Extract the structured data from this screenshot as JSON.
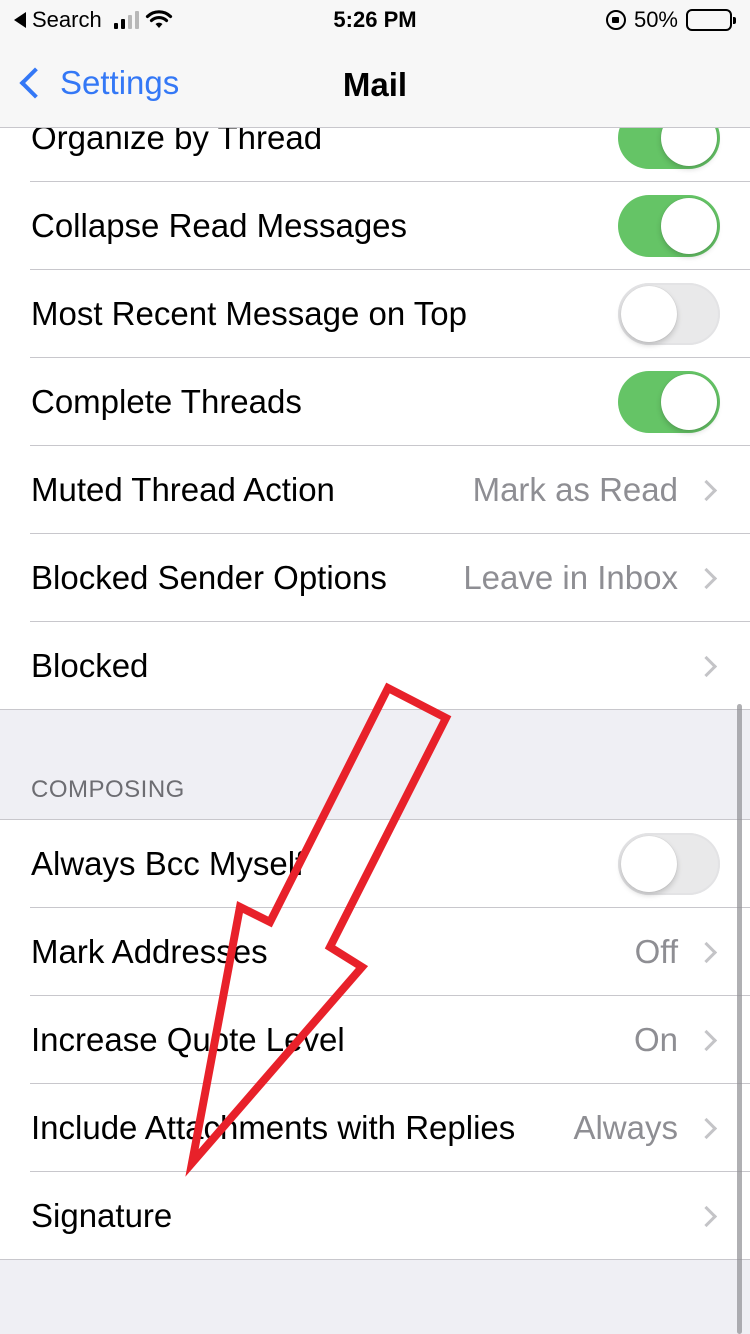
{
  "status_bar": {
    "back_app": "Search",
    "time": "5:26 PM",
    "battery_percent": "50%",
    "battery_level": 0.5
  },
  "nav": {
    "back_label": "Settings",
    "title": "Mail"
  },
  "threading_rows": [
    {
      "label": "Organize by Thread",
      "control": "toggle",
      "on": true
    },
    {
      "label": "Collapse Read Messages",
      "control": "toggle",
      "on": true
    },
    {
      "label": "Most Recent Message on Top",
      "control": "toggle",
      "on": false
    },
    {
      "label": "Complete Threads",
      "control": "toggle",
      "on": true
    },
    {
      "label": "Muted Thread Action",
      "value": "Mark as Read",
      "control": "disclosure"
    },
    {
      "label": "Blocked Sender Options",
      "value": "Leave in Inbox",
      "control": "disclosure"
    },
    {
      "label": "Blocked",
      "control": "disclosure"
    }
  ],
  "composing": {
    "header": "COMPOSING",
    "rows": [
      {
        "label": "Always Bcc Myself",
        "control": "toggle",
        "on": false
      },
      {
        "label": "Mark Addresses",
        "value": "Off",
        "control": "disclosure"
      },
      {
        "label": "Increase Quote Level",
        "value": "On",
        "control": "disclosure"
      },
      {
        "label": "Include Attachments with Replies",
        "value": "Always",
        "control": "disclosure"
      },
      {
        "label": "Signature",
        "control": "disclosure"
      }
    ]
  },
  "colors": {
    "toggle_on": "#65c466",
    "accent": "#3478f6",
    "annotation_arrow": "#e8212a"
  }
}
